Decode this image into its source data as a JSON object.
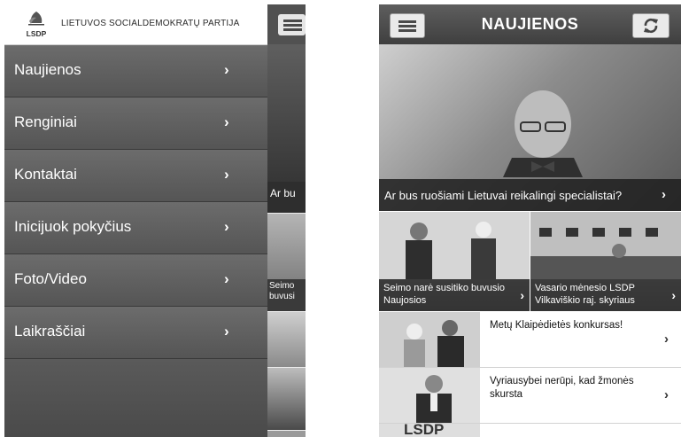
{
  "left_screen": {
    "brand": {
      "logo_text": "LSDP",
      "title": "LIETUVOS SOCIALDEMOKRATŲ PARTIJA"
    },
    "menu": {
      "items": [
        {
          "label": "Naujienos"
        },
        {
          "label": "Renginiai"
        },
        {
          "label": "Kontaktai"
        },
        {
          "label": "Inicijuok pokyčius"
        },
        {
          "label": "Foto/Video"
        },
        {
          "label": "Laikraščiai"
        }
      ],
      "chevron": "›"
    },
    "behind": {
      "caption_1": "Ar bu",
      "caption_2_line1": "Seimo",
      "caption_2_line2": "buvusi"
    }
  },
  "right_screen": {
    "header": {
      "title": "NAUJIENOS",
      "menu_icon": "hamburger-icon",
      "refresh_icon": "refresh-icon"
    },
    "hero": {
      "caption": "Ar bus ruošiami Lietuvai reikalingi specialistai?"
    },
    "tiles": [
      {
        "caption": "Seimo narė susitiko buvusio Naujosios"
      },
      {
        "caption": "Vasario mėnesio LSDP Vilkaviškio raj. skyriaus"
      }
    ],
    "list": [
      {
        "title": "Metų Klaipėdietės konkursas!"
      },
      {
        "title": "Vyriausybei nerūpi, kad žmonės skursta"
      },
      {
        "title": "",
        "thumb_text": "LSDP"
      }
    ],
    "chevron": "›"
  },
  "colors": {
    "menu_bg": "#5c5c5c",
    "nav_bar": "#4a4a4a",
    "caption_overlay": "#2e2e2e",
    "text_light": "#ffffff"
  }
}
